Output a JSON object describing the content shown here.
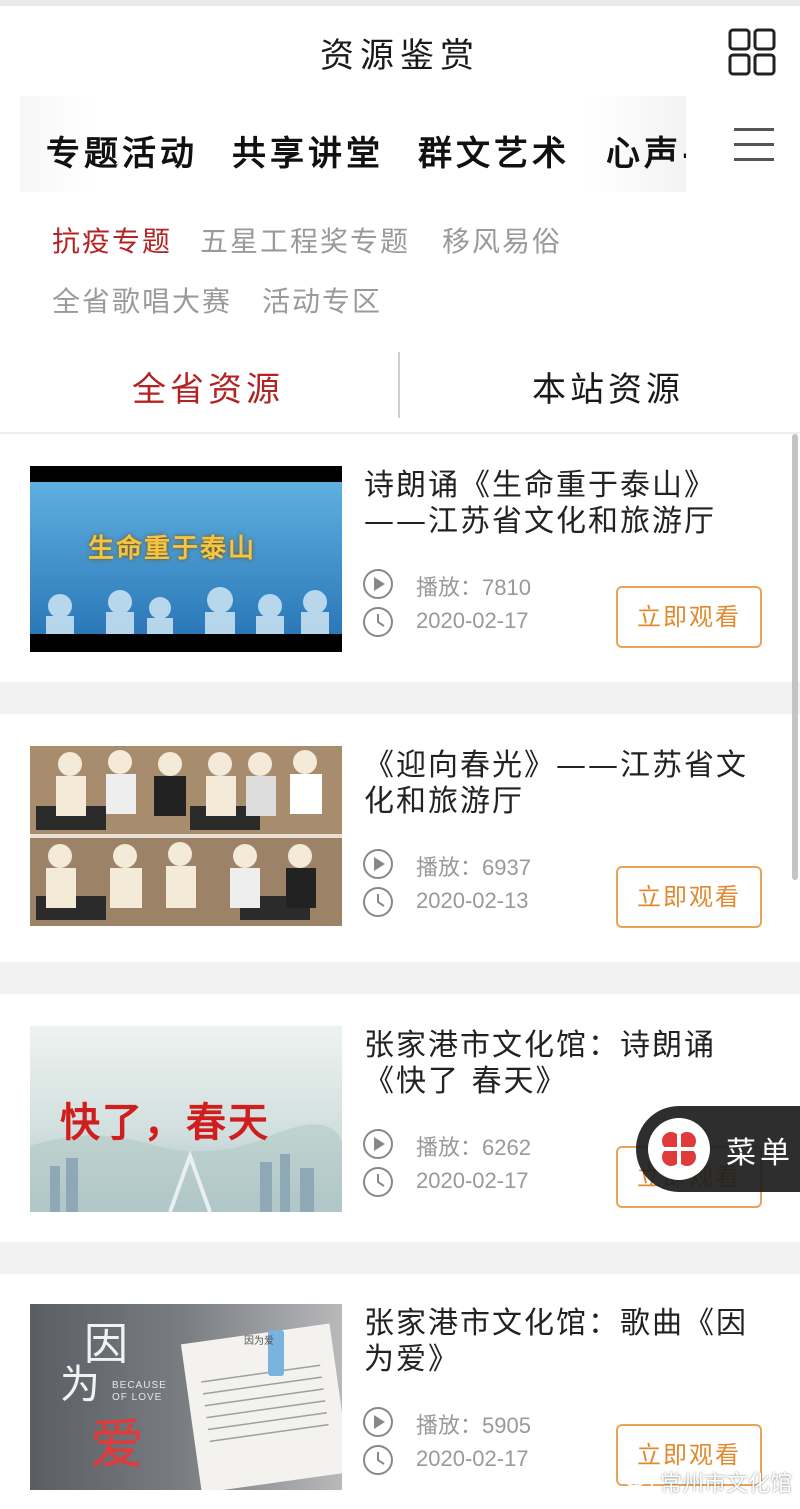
{
  "header": {
    "title": "资源鉴赏",
    "grid_icon": "grid-icon"
  },
  "category_nav": {
    "items": [
      "专题活动",
      "共享讲堂",
      "群文艺术",
      "心声-"
    ],
    "menu_icon": "hamburger-icon"
  },
  "subtopics": {
    "active": "抗疫专题",
    "items": [
      "抗疫专题",
      "五星工程奖专题",
      "移风易俗",
      "全省歌唱大赛",
      "活动专区"
    ]
  },
  "source_tabs": {
    "active": "全省资源",
    "items": [
      "全省资源",
      "本站资源"
    ]
  },
  "cards": [
    {
      "title": "诗朗诵《生命重于泰山》——江苏省文化和旅游厅",
      "thumb_text": "生命重于泰山",
      "play_label": "播放：",
      "plays": "7810",
      "date": "2020-02-17",
      "button": "立即观看"
    },
    {
      "title": "《迎向春光》——江苏省文化和旅游厅",
      "thumb_text": "",
      "play_label": "播放：",
      "plays": "6937",
      "date": "2020-02-13",
      "button": "立即观看"
    },
    {
      "title": "张家港市文化馆：诗朗诵《快了 春天》",
      "thumb_text": "快了，春天",
      "play_label": "播放：",
      "plays": "6262",
      "date": "2020-02-17",
      "button": "立即观看"
    },
    {
      "title": "张家港市文化馆：歌曲《因为爱》",
      "thumb_text_1": "因",
      "thumb_text_2": "为",
      "thumb_text_3": "爱",
      "thumb_text_en": "BECAUSE OF LOVE",
      "thumb_doc": "因为爱",
      "play_label": "播放：",
      "plays": "5905",
      "date": "2020-02-17",
      "button": "立即观看"
    }
  ],
  "floating_menu": {
    "label": "菜单",
    "icon": "four-petal-icon"
  },
  "watermark": {
    "text": "常州市文化馆",
    "icon": "wechat-icon"
  },
  "colors": {
    "accent_red": "#b42323",
    "button_orange": "#e28a30",
    "menu_red": "#e03a3a"
  }
}
